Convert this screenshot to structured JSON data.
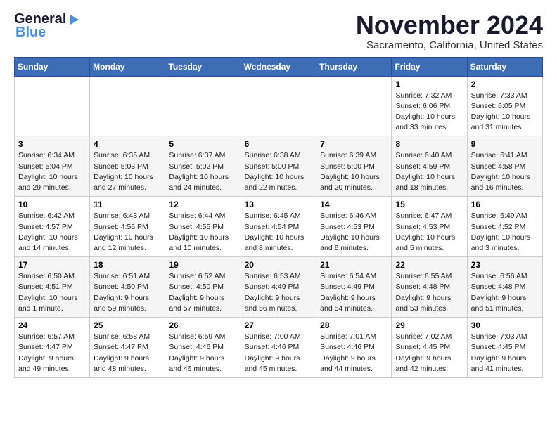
{
  "logo": {
    "line1": "General",
    "line2": "Blue"
  },
  "title": "November 2024",
  "location": "Sacramento, California, United States",
  "days_of_week": [
    "Sunday",
    "Monday",
    "Tuesday",
    "Wednesday",
    "Thursday",
    "Friday",
    "Saturday"
  ],
  "weeks": [
    [
      {
        "day": "",
        "info": ""
      },
      {
        "day": "",
        "info": ""
      },
      {
        "day": "",
        "info": ""
      },
      {
        "day": "",
        "info": ""
      },
      {
        "day": "",
        "info": ""
      },
      {
        "day": "1",
        "info": "Sunrise: 7:32 AM\nSunset: 6:06 PM\nDaylight: 10 hours\nand 33 minutes."
      },
      {
        "day": "2",
        "info": "Sunrise: 7:33 AM\nSunset: 6:05 PM\nDaylight: 10 hours\nand 31 minutes."
      }
    ],
    [
      {
        "day": "3",
        "info": "Sunrise: 6:34 AM\nSunset: 5:04 PM\nDaylight: 10 hours\nand 29 minutes."
      },
      {
        "day": "4",
        "info": "Sunrise: 6:35 AM\nSunset: 5:03 PM\nDaylight: 10 hours\nand 27 minutes."
      },
      {
        "day": "5",
        "info": "Sunrise: 6:37 AM\nSunset: 5:02 PM\nDaylight: 10 hours\nand 24 minutes."
      },
      {
        "day": "6",
        "info": "Sunrise: 6:38 AM\nSunset: 5:00 PM\nDaylight: 10 hours\nand 22 minutes."
      },
      {
        "day": "7",
        "info": "Sunrise: 6:39 AM\nSunset: 5:00 PM\nDaylight: 10 hours\nand 20 minutes."
      },
      {
        "day": "8",
        "info": "Sunrise: 6:40 AM\nSunset: 4:59 PM\nDaylight: 10 hours\nand 18 minutes."
      },
      {
        "day": "9",
        "info": "Sunrise: 6:41 AM\nSunset: 4:58 PM\nDaylight: 10 hours\nand 16 minutes."
      }
    ],
    [
      {
        "day": "10",
        "info": "Sunrise: 6:42 AM\nSunset: 4:57 PM\nDaylight: 10 hours\nand 14 minutes."
      },
      {
        "day": "11",
        "info": "Sunrise: 6:43 AM\nSunset: 4:56 PM\nDaylight: 10 hours\nand 12 minutes."
      },
      {
        "day": "12",
        "info": "Sunrise: 6:44 AM\nSunset: 4:55 PM\nDaylight: 10 hours\nand 10 minutes."
      },
      {
        "day": "13",
        "info": "Sunrise: 6:45 AM\nSunset: 4:54 PM\nDaylight: 10 hours\nand 8 minutes."
      },
      {
        "day": "14",
        "info": "Sunrise: 6:46 AM\nSunset: 4:53 PM\nDaylight: 10 hours\nand 6 minutes."
      },
      {
        "day": "15",
        "info": "Sunrise: 6:47 AM\nSunset: 4:53 PM\nDaylight: 10 hours\nand 5 minutes."
      },
      {
        "day": "16",
        "info": "Sunrise: 6:49 AM\nSunset: 4:52 PM\nDaylight: 10 hours\nand 3 minutes."
      }
    ],
    [
      {
        "day": "17",
        "info": "Sunrise: 6:50 AM\nSunset: 4:51 PM\nDaylight: 10 hours\nand 1 minute."
      },
      {
        "day": "18",
        "info": "Sunrise: 6:51 AM\nSunset: 4:50 PM\nDaylight: 9 hours\nand 59 minutes."
      },
      {
        "day": "19",
        "info": "Sunrise: 6:52 AM\nSunset: 4:50 PM\nDaylight: 9 hours\nand 57 minutes."
      },
      {
        "day": "20",
        "info": "Sunrise: 6:53 AM\nSunset: 4:49 PM\nDaylight: 9 hours\nand 56 minutes."
      },
      {
        "day": "21",
        "info": "Sunrise: 6:54 AM\nSunset: 4:49 PM\nDaylight: 9 hours\nand 54 minutes."
      },
      {
        "day": "22",
        "info": "Sunrise: 6:55 AM\nSunset: 4:48 PM\nDaylight: 9 hours\nand 53 minutes."
      },
      {
        "day": "23",
        "info": "Sunrise: 6:56 AM\nSunset: 4:48 PM\nDaylight: 9 hours\nand 51 minutes."
      }
    ],
    [
      {
        "day": "24",
        "info": "Sunrise: 6:57 AM\nSunset: 4:47 PM\nDaylight: 9 hours\nand 49 minutes."
      },
      {
        "day": "25",
        "info": "Sunrise: 6:58 AM\nSunset: 4:47 PM\nDaylight: 9 hours\nand 48 minutes."
      },
      {
        "day": "26",
        "info": "Sunrise: 6:59 AM\nSunset: 4:46 PM\nDaylight: 9 hours\nand 46 minutes."
      },
      {
        "day": "27",
        "info": "Sunrise: 7:00 AM\nSunset: 4:46 PM\nDaylight: 9 hours\nand 45 minutes."
      },
      {
        "day": "28",
        "info": "Sunrise: 7:01 AM\nSunset: 4:46 PM\nDaylight: 9 hours\nand 44 minutes."
      },
      {
        "day": "29",
        "info": "Sunrise: 7:02 AM\nSunset: 4:45 PM\nDaylight: 9 hours\nand 42 minutes."
      },
      {
        "day": "30",
        "info": "Sunrise: 7:03 AM\nSunset: 4:45 PM\nDaylight: 9 hours\nand 41 minutes."
      }
    ]
  ]
}
